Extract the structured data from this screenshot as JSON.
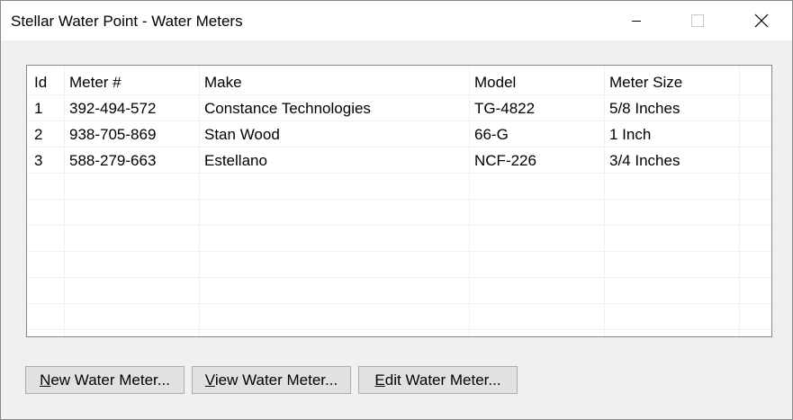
{
  "window": {
    "title": "Stellar Water Point - Water Meters"
  },
  "columns": [
    {
      "label": "Id"
    },
    {
      "label": "Meter #"
    },
    {
      "label": "Make"
    },
    {
      "label": "Model"
    },
    {
      "label": "Meter Size"
    }
  ],
  "rows": [
    {
      "id": "1",
      "meter": "392-494-572",
      "make": "Constance Technologies",
      "model": "TG-4822",
      "size": "5/8 Inches"
    },
    {
      "id": "2",
      "meter": "938-705-869",
      "make": "Stan Wood",
      "model": "66-G",
      "size": "1 Inch"
    },
    {
      "id": "3",
      "meter": "588-279-663",
      "make": "Estellano",
      "model": "NCF-226",
      "size": "3/4 Inches"
    }
  ],
  "buttons": {
    "new": {
      "mnemonic": "N",
      "rest": "ew Water Meter..."
    },
    "view": {
      "mnemonic": "V",
      "rest": "iew Water Meter..."
    },
    "edit": {
      "mnemonic": "E",
      "rest": "dit Water Meter..."
    }
  }
}
